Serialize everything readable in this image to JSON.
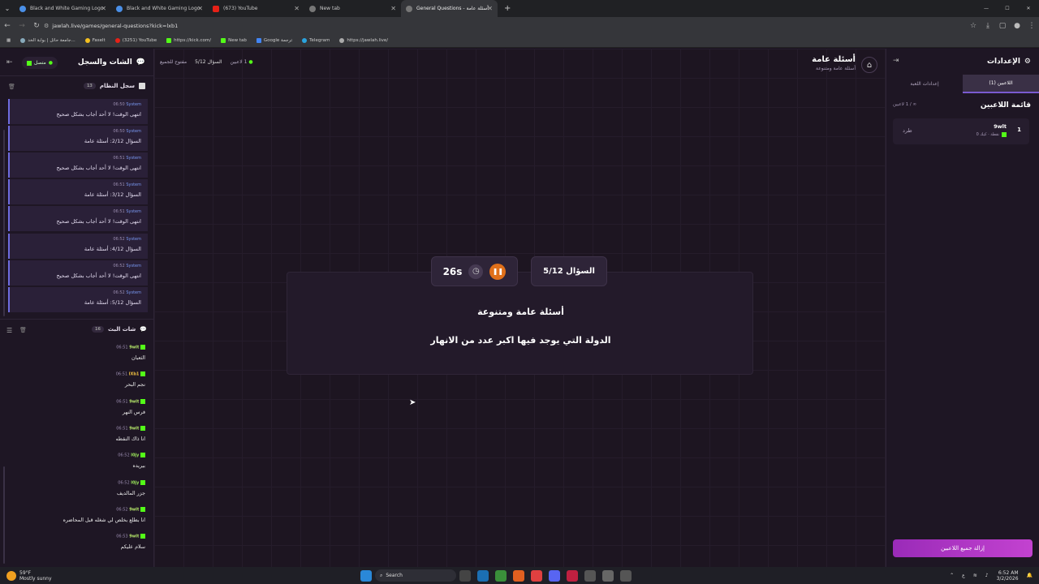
{
  "browser": {
    "tabs": [
      {
        "label": "Black and White Gaming Logo",
        "icon": "globe-icon"
      },
      {
        "label": "Black and White Gaming Logo",
        "icon": "globe-icon"
      },
      {
        "label": "(673) YouTube",
        "icon": "youtube-icon"
      },
      {
        "label": "New tab",
        "icon": "globe-icon"
      },
      {
        "label": "General Questions - أسئلة عامة",
        "icon": "globe-icon"
      }
    ],
    "url": "jawlah.live/games/general-questions?kick=lxb1",
    "bookmarks": [
      "جامعة حائل | بوابة الخد...",
      "Faselt",
      "(3251) YouTube",
      "https://kick.com/",
      "New tab",
      "Google ترجمة",
      "Telegram",
      "https://jawlah.live/"
    ]
  },
  "left_panel": {
    "title": "الشات والسجل",
    "status": "متصل",
    "system_log_title": "سجل النظام",
    "system_log_count": "13",
    "system_messages": [
      {
        "time": "06:50",
        "sender": "System",
        "text": "انتهى الوقت! لا أحد أجاب بشكل صحيح"
      },
      {
        "time": "06:50",
        "sender": "System",
        "text": "السؤال 2/12: أسئلة عامة"
      },
      {
        "time": "06:51",
        "sender": "System",
        "text": "انتهى الوقت! لا أحد أجاب بشكل صحيح"
      },
      {
        "time": "06:51",
        "sender": "System",
        "text": "السؤال 3/12: أسئلة عامة"
      },
      {
        "time": "06:51",
        "sender": "System",
        "text": "انتهى الوقت! لا أحد أجاب بشكل صحيح"
      },
      {
        "time": "06:52",
        "sender": "System",
        "text": "السؤال 4/12: أسئلة عامة"
      },
      {
        "time": "06:52",
        "sender": "System",
        "text": "انتهى الوقت! لا أحد أجاب بشكل صحيح"
      },
      {
        "time": "06:52",
        "sender": "System",
        "text": "السؤال 5/12: أسئلة عامة"
      }
    ],
    "chat_title": "شات البث",
    "chat_count": "16",
    "chat_messages": [
      {
        "time": "06:51",
        "user": "9wlt",
        "text": "الثعبان"
      },
      {
        "time": "06:51",
        "user": "lXb1",
        "text": "نجم البحر"
      },
      {
        "time": "06:51",
        "user": "9wlt",
        "text": "فرس النهر"
      },
      {
        "time": "06:51",
        "user": "9wlt",
        "text": "انا ذاك النقطه"
      },
      {
        "time": "06:52",
        "user": "l0jy",
        "text": "بيريده"
      },
      {
        "time": "06:52",
        "user": "l0jy",
        "text": "جزر المالديف"
      },
      {
        "time": "06:52",
        "user": "9wlt",
        "text": "انا بطلع بخلص لي شغله قبل المحاضره"
      },
      {
        "time": "06:53",
        "user": "9wlt",
        "text": "سلام عليكم"
      }
    ]
  },
  "header": {
    "title": "أسئلة عامة",
    "subtitle": "أسئلة عامة ومتنوعة",
    "players_badge": "1 لاعبين",
    "question_badge": "السؤال 5/12",
    "open_badge": "مفتوح للجميع"
  },
  "question": {
    "timer": "26s",
    "counter": "السؤال 5/12",
    "category": "أسئلة عامة ومتنوعة",
    "text": "الدولة التي يوجد فيها اكبر عدد من الانهار"
  },
  "right_panel": {
    "title": "الإعدادات",
    "tabs": [
      "اللاعبين (1)",
      "إعدادات اللعبة"
    ],
    "list_title": "قائمة اللاعبين",
    "count_label": "∞ / 1 لاعبين",
    "players": [
      {
        "rank": "1",
        "name": "9wlt",
        "meta": "0 نقطة · كيك",
        "kick_label": "طرد"
      }
    ],
    "remove_all": "إزالة جميع اللاعبين"
  },
  "taskbar": {
    "weather_temp": "59°F",
    "weather_desc": "Mostly sunny",
    "search": "Search",
    "lang": "ع",
    "time": "6:52 AM",
    "date": "3/2/2026"
  }
}
